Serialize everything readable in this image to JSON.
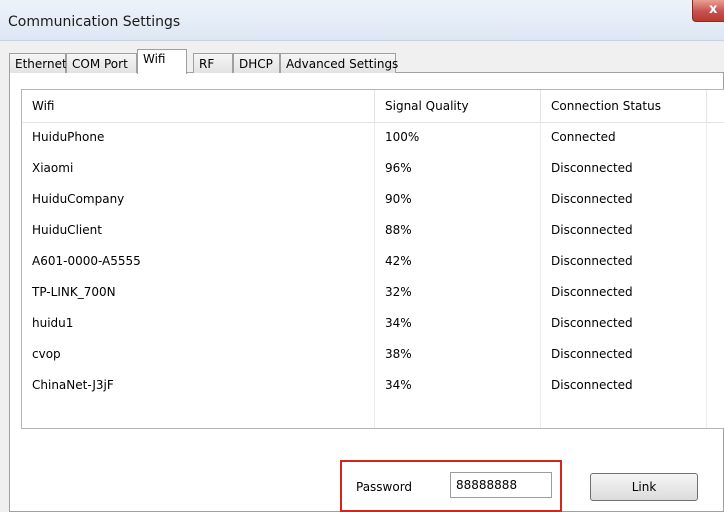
{
  "window": {
    "title": "Communication Settings",
    "close_glyph": "x"
  },
  "tabs": [
    {
      "label": "Ethernet"
    },
    {
      "label": "COM Port"
    },
    {
      "label": "Wifi",
      "active": true
    },
    {
      "label": "RF"
    },
    {
      "label": "DHCP"
    },
    {
      "label": "Advanced Settings"
    }
  ],
  "wifi_table": {
    "columns": [
      "Wifi",
      "Signal Quality",
      "Connection Status"
    ],
    "rows": [
      {
        "name": "HuiduPhone",
        "signal": "100%",
        "status": "Connected"
      },
      {
        "name": "Xiaomi",
        "signal": "96%",
        "status": "Disconnected"
      },
      {
        "name": "HuiduCompany",
        "signal": "90%",
        "status": "Disconnected"
      },
      {
        "name": "HuiduClient",
        "signal": "88%",
        "status": "Disconnected"
      },
      {
        "name": "A601-0000-A5555",
        "signal": "42%",
        "status": "Disconnected"
      },
      {
        "name": "TP-LINK_700N",
        "signal": "32%",
        "status": "Disconnected"
      },
      {
        "name": "huidu1",
        "signal": "34%",
        "status": "Disconnected"
      },
      {
        "name": "cvop",
        "signal": "38%",
        "status": "Disconnected"
      },
      {
        "name": "ChinaNet-J3jF",
        "signal": "34%",
        "status": "Disconnected"
      }
    ]
  },
  "password": {
    "label": "Password",
    "value": "88888888"
  },
  "link_button": {
    "label": "Link"
  },
  "colors": {
    "highlight_frame": "#d9211e",
    "close_button": "#c75050"
  }
}
